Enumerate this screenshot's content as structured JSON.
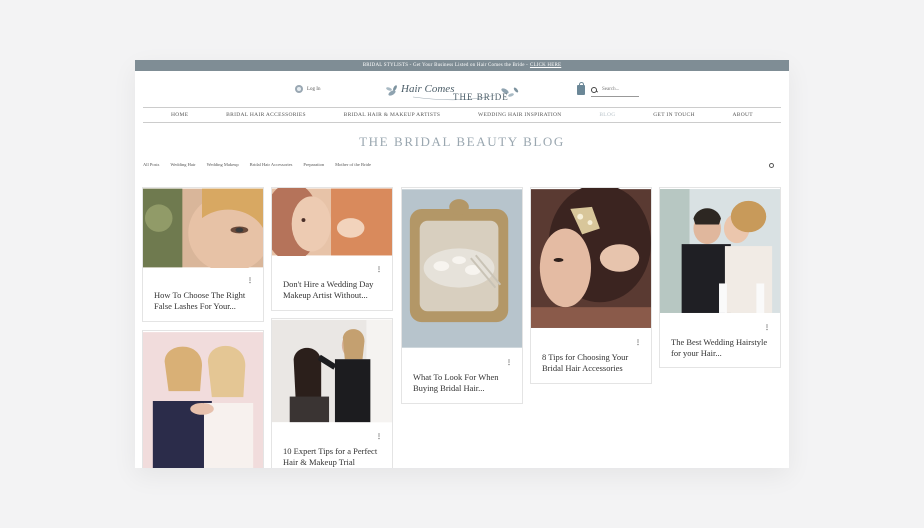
{
  "topbar": {
    "text": "BRIDAL STYLISTS - Get Your Business Listed on Hair Comes the Bride - ",
    "cta": "CLICK HERE"
  },
  "header": {
    "login_label": "Log In",
    "logo": {
      "line1": "Hair Comes",
      "line2": "THE BRIDE"
    },
    "search_placeholder": "Search..."
  },
  "nav": {
    "items": [
      {
        "label": "HOME"
      },
      {
        "label": "BRIDAL HAIR ACCESSORIES"
      },
      {
        "label": "BRIDAL HAIR & MAKEUP ARTISTS"
      },
      {
        "label": "WEDDING HAIR INSPIRATION"
      },
      {
        "label": "BLOG"
      },
      {
        "label": "GET IN TOUCH"
      },
      {
        "label": "ABOUT"
      }
    ],
    "active": "BLOG"
  },
  "blog": {
    "title": "THE BRIDAL BEAUTY BLOG",
    "filters": [
      "All Posts",
      "Wedding Hair",
      "Wedding Makeup",
      "Bridal Hair Accessories",
      "Preparation",
      "Mother of the Bride"
    ]
  },
  "posts": [
    {
      "title": "How To Choose The Right False Lashes For Your..."
    },
    {
      "title": "Don't Hire a Wedding Day Makeup Artist Without..."
    },
    {
      "title": "What To Look For When Buying Bridal Hair..."
    },
    {
      "title": "8 Tips for Choosing Your Bridal Hair Accessories"
    },
    {
      "title": "The Best Wedding Hairstyle for your Hair..."
    },
    {
      "title": "10 Expert Tips for a Perfect Hair & Makeup Trial"
    },
    {
      "title": ""
    }
  ],
  "more_icon": "⋮",
  "colors": {
    "topbar": "#7f8d95",
    "accent": "#9aa7b0"
  }
}
